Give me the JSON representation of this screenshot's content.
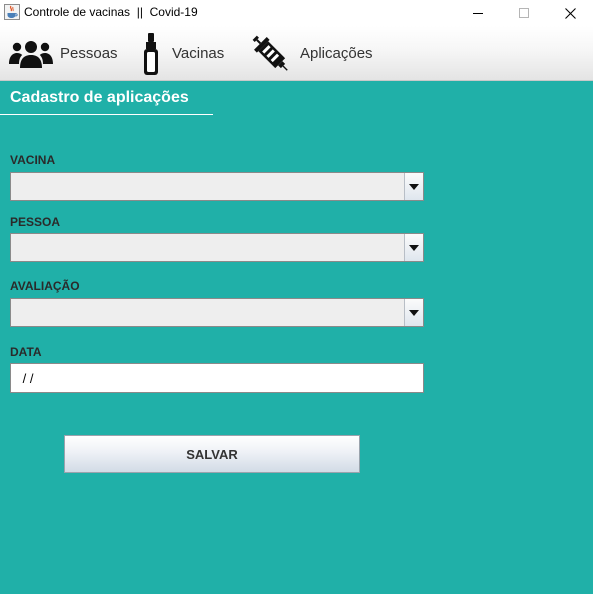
{
  "window": {
    "title": "Controle de vacinas  ||  Covid-19",
    "icon": "java-cup-icon",
    "controls": {
      "minimize": "minimize-icon",
      "maximize": "maximize-icon",
      "close": "close-icon"
    }
  },
  "toolbar": {
    "items": [
      {
        "label": "Pessoas",
        "icon": "people-icon"
      },
      {
        "label": "Vacinas",
        "icon": "vaccine-vial-icon"
      },
      {
        "label": "Aplicações",
        "icon": "syringe-icon"
      }
    ]
  },
  "main": {
    "background": "#20b0a8",
    "section_title": "Cadastro de aplicações",
    "fields": {
      "vacina": {
        "label": "VACINA",
        "value": ""
      },
      "pessoa": {
        "label": "PESSOA",
        "value": ""
      },
      "avaliacao": {
        "label": "AVALIAÇÃO",
        "value": ""
      },
      "data": {
        "label": "DATA",
        "value": " / /"
      }
    },
    "save_label": "SALVAR"
  }
}
